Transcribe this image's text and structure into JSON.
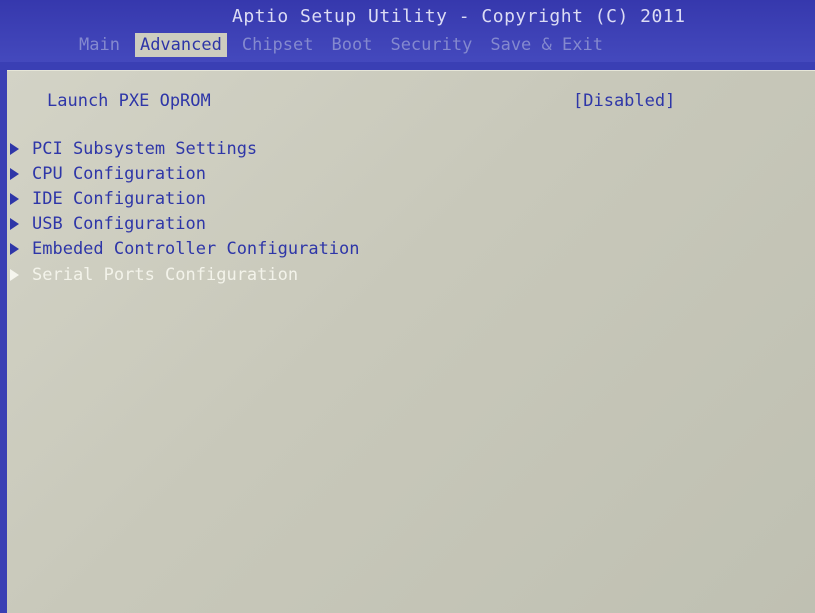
{
  "header": {
    "title": "Aptio Setup Utility - Copyright (C) 2011",
    "tabs": [
      {
        "label": "Main",
        "active": false
      },
      {
        "label": "Advanced",
        "active": true
      },
      {
        "label": "Chipset",
        "active": false
      },
      {
        "label": "Boot",
        "active": false
      },
      {
        "label": "Security",
        "active": false
      },
      {
        "label": "Save & Exit",
        "active": false
      }
    ]
  },
  "main": {
    "option": {
      "label": "Launch PXE OpROM",
      "value": "[Disabled]"
    },
    "submenus": [
      {
        "label": "PCI Subsystem Settings",
        "selected": false
      },
      {
        "label": "CPU Configuration",
        "selected": false
      },
      {
        "label": "IDE Configuration",
        "selected": false
      },
      {
        "label": "USB Configuration",
        "selected": false
      },
      {
        "label": "Embeded Controller Configuration",
        "selected": false
      },
      {
        "label": "Serial Ports Configuration",
        "selected": true
      }
    ]
  },
  "colors": {
    "background": "#3a3fb4",
    "panel": "#c9c9bb",
    "active_tab_bg": "#cdcdbf",
    "text_blue": "#2e36a8",
    "highlight_text": "#f3f3ea",
    "inactive_tab_text": "#8489cf"
  }
}
